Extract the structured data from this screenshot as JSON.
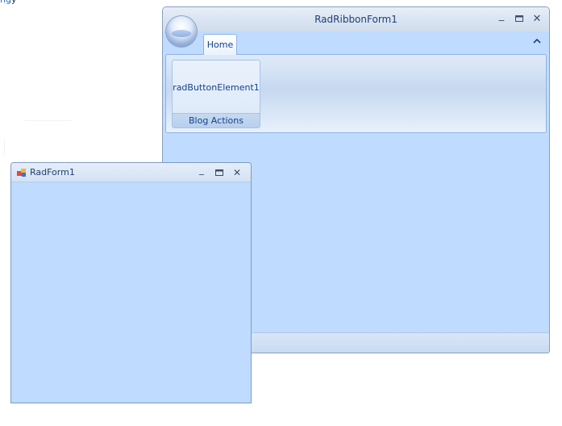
{
  "background": {
    "corner_link": "ng",
    "corner_suffix": "y"
  },
  "ribbon_form": {
    "title": "RadRibbonForm1",
    "window_buttons": {
      "minimize": "_",
      "maximize": "🗖",
      "close": "✕"
    },
    "tabs": [
      {
        "label": "Home",
        "selected": true
      }
    ],
    "collapse_glyph": "^",
    "groups": [
      {
        "button_label": "radButtonElement1",
        "caption": "Blog Actions"
      }
    ],
    "colors": {
      "client": "#bfdbff",
      "title_text": "#1f3f74",
      "group_text": "#15428b"
    }
  },
  "rad_form": {
    "title": "RadForm1",
    "icon": "app-icon",
    "window_buttons": {
      "minimize": "_",
      "maximize": "🗖",
      "close": "✕"
    },
    "colors": {
      "client": "#bfdbff"
    }
  }
}
